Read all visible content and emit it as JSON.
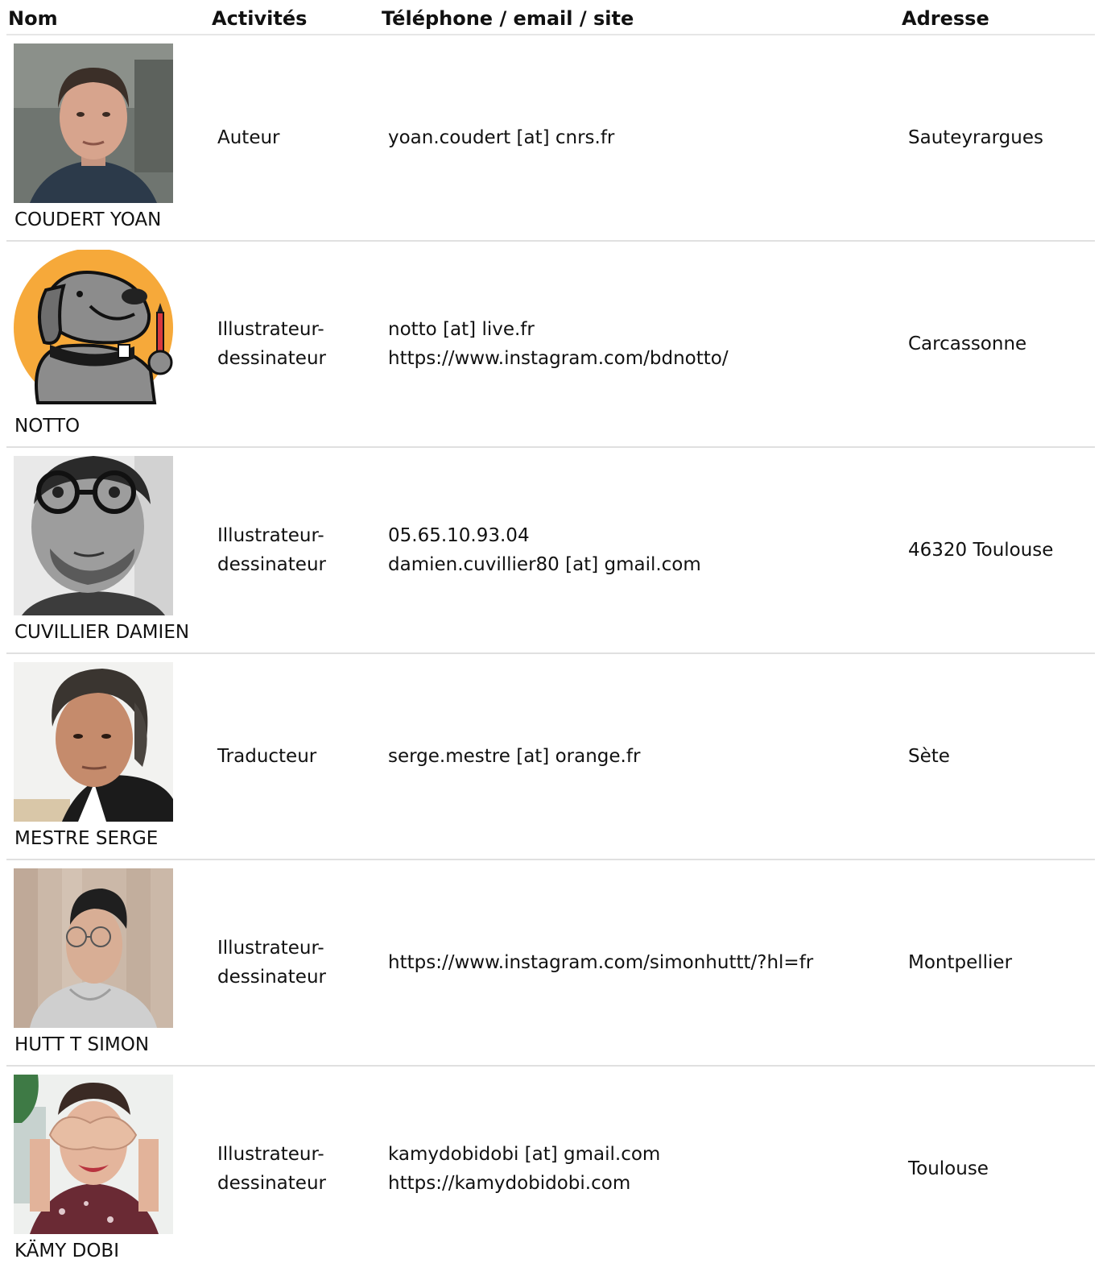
{
  "columns": {
    "name": "Nom",
    "activities": "Activités",
    "contact": "Téléphone / email / site",
    "address": "Adresse"
  },
  "rows": [
    {
      "name": "COUDERT YOAN",
      "activity": [
        "Auteur"
      ],
      "contact": [
        "yoan.coudert [at] cnrs.fr"
      ],
      "address": "Sauteyrargues"
    },
    {
      "name": "NOTTO",
      "activity": [
        "Illustrateur-",
        "dessinateur"
      ],
      "contact": [
        "notto [at] live.fr",
        "https://www.instagram.com/bdnotto/"
      ],
      "address": "Carcassonne"
    },
    {
      "name": "CUVILLIER DAMIEN",
      "activity": [
        "Illustrateur-",
        "dessinateur"
      ],
      "contact": [
        "05.65.10.93.04",
        "damien.cuvillier80 [at] gmail.com"
      ],
      "address": "46320 Toulouse"
    },
    {
      "name": "MESTRE SERGE",
      "activity": [
        "Traducteur"
      ],
      "contact": [
        "serge.mestre [at] orange.fr"
      ],
      "address": "Sète"
    },
    {
      "name": "HUTT T SIMON",
      "activity": [
        "Illustrateur-",
        "dessinateur"
      ],
      "contact": [
        "https://www.instagram.com/simonhuttt/?hl=fr"
      ],
      "address": "Montpellier"
    },
    {
      "name": "KÄMY DOBI",
      "activity": [
        "Illustrateur-",
        "dessinateur"
      ],
      "contact": [
        "kamydobidobi [at] gmail.com",
        "https://kamydobidobi.com"
      ],
      "address": "Toulouse"
    }
  ]
}
